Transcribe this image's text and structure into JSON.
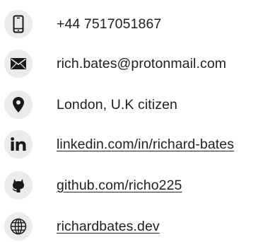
{
  "contacts": {
    "phone": {
      "icon": "phone-icon",
      "text": "+44 7517051867"
    },
    "email": {
      "icon": "mail-icon",
      "text": "rich.bates@protonmail.com"
    },
    "location": {
      "icon": "location-pin-icon",
      "text": "London, U.K citizen"
    },
    "linkedin": {
      "icon": "linkedin-icon",
      "text": "linkedin.com/in/richard-bates",
      "link": true
    },
    "github": {
      "icon": "github-icon",
      "text": "github.com/richo225",
      "link": true
    },
    "website": {
      "icon": "globe-icon",
      "text": "richardbates.dev",
      "link": true
    }
  },
  "colors": {
    "icon_background": "#ebebeb",
    "icon_foreground": "#1a1a1a",
    "text": "#1f1f1f"
  }
}
